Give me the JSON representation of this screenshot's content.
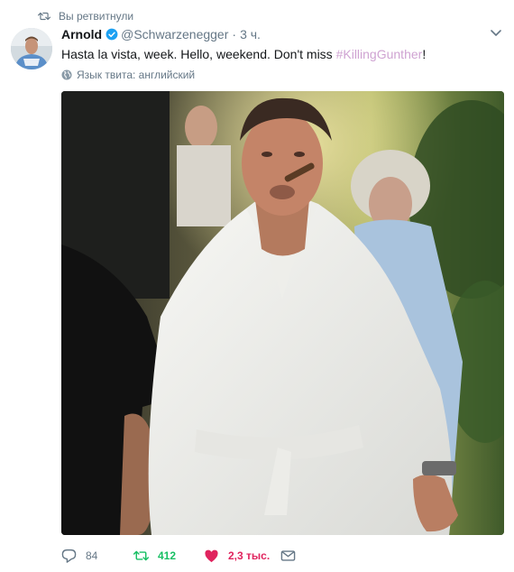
{
  "retweet": {
    "label": "Вы ретвитнули"
  },
  "author": {
    "name": "Arnold",
    "handle": "@Schwarzenegger",
    "time": "3 ч."
  },
  "tweet": {
    "text": "Hasta la vista, week. Hello, weekend. Don't miss ",
    "hashtag": "#KillingGunther",
    "text_end": "!"
  },
  "language": {
    "label": "Язык твита: английский"
  },
  "actions": {
    "replies": "84",
    "retweets": "412",
    "likes": "2,3 тыс."
  },
  "colors": {
    "retweet": "#17bf63",
    "like": "#e0245e",
    "hashtag": "#cfa3d2",
    "muted": "#657786"
  },
  "icons": [
    "retweet-icon",
    "verified-badge-icon",
    "caret-down-icon",
    "globe-icon",
    "reply-icon",
    "like-icon",
    "direct-message-icon"
  ]
}
